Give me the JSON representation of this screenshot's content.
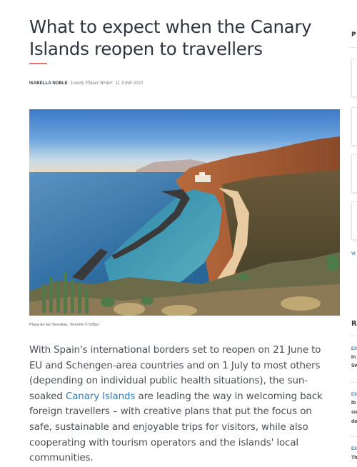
{
  "article": {
    "title": "What to expect when the Canary Islands reopen to travellers",
    "author": "ISABELLA NOBLE",
    "author_role": "Lonely Planet Writer",
    "date": "11 JUNE 2020",
    "image_caption": "Playa de las Teresitas, Tenerife © 500px",
    "body_before_link": "With Spain's international borders set to reopen on 21 June to EU and Schengen-area countries and on 1 July to most others (depending on individual public health situations), the sun-soaked ",
    "body_link": "Canary Islands",
    "body_after_link": " are leading the way in welcoming back foreign travellers – with creative plans that put the focus on safe, sustainable and enjoyable trips for visitors, while also cooperating with tourism operators and the islands' local communities."
  },
  "sidebar": {
    "section1_letter": "P",
    "view_link": "VI",
    "section2_letter": "R",
    "item1_tag": "EX",
    "item1_text": [
      "In",
      "Sw"
    ],
    "item2_tag": "EX",
    "item2_text": [
      "Ib",
      "su",
      "da"
    ],
    "item3_tag": "EX",
    "item3_text": [
      "Th"
    ]
  },
  "colors": {
    "title": "#2f3540",
    "accent_underline": "#e8726a",
    "link": "#2f7cc1",
    "body": "#4a4e57"
  }
}
